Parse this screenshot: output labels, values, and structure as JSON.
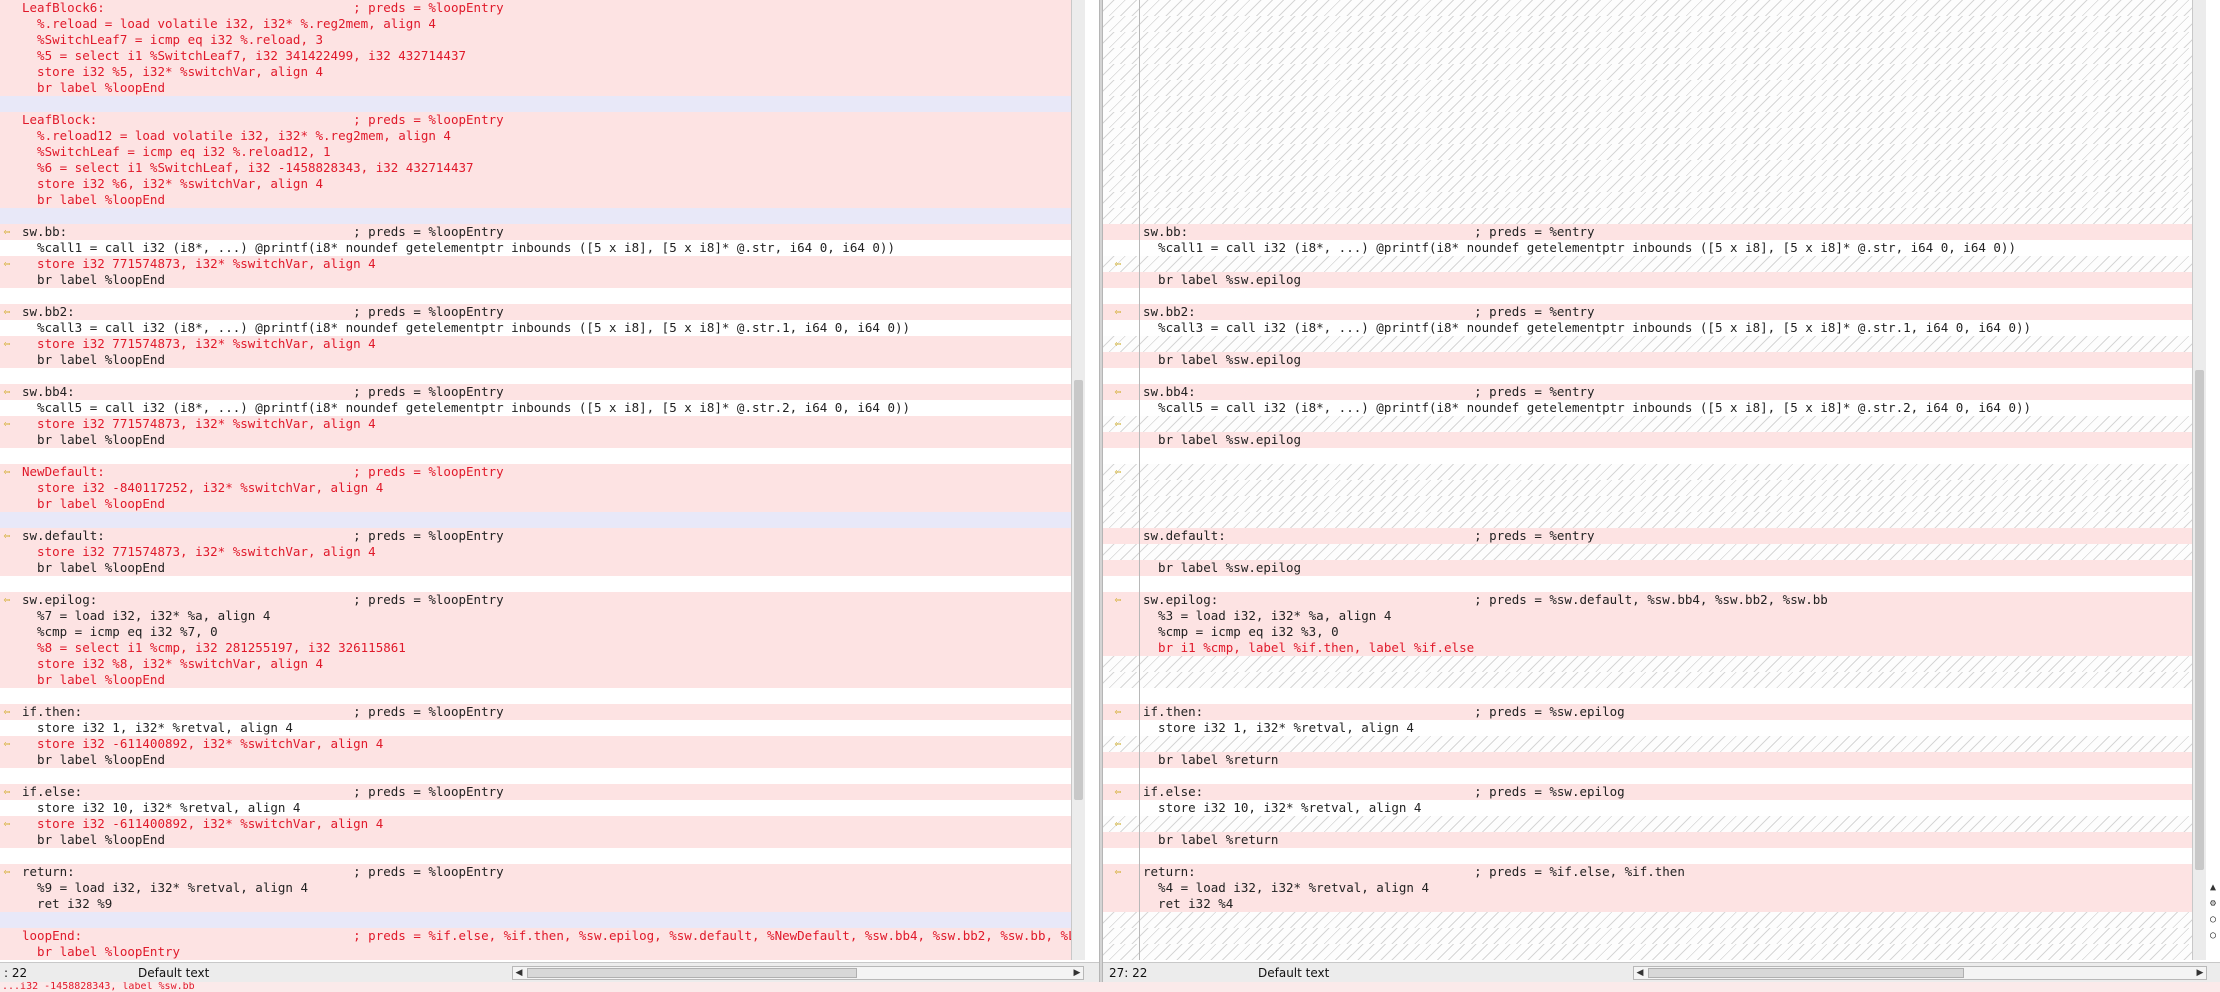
{
  "left_pane": {
    "lines": [
      {
        "text": "LeafBlock6:                                 ; preds = %loopEntry",
        "k": "hl",
        "c": 1
      },
      {
        "text": "  %.reload = load volatile i32, i32* %.reg2mem, align 4",
        "k": "hl",
        "c": 1
      },
      {
        "text": "  %SwitchLeaf7 = icmp eq i32 %.reload, 3",
        "k": "hl",
        "c": 1
      },
      {
        "text": "  %5 = select i1 %SwitchLeaf7, i32 341422499, i32 432714437",
        "k": "hl",
        "c": 1
      },
      {
        "text": "  store i32 %5, i32* %switchVar, align 4",
        "k": "hl",
        "c": 1
      },
      {
        "text": "  br label %loopEnd",
        "k": "hl",
        "c": 1
      },
      {
        "text": "",
        "k": "sep",
        "c": 0
      },
      {
        "text": "LeafBlock:                                  ; preds = %loopEntry",
        "k": "hl",
        "c": 1
      },
      {
        "text": "  %.reload12 = load volatile i32, i32* %.reg2mem, align 4",
        "k": "hl",
        "c": 1
      },
      {
        "text": "  %SwitchLeaf = icmp eq i32 %.reload12, 1",
        "k": "hl",
        "c": 1
      },
      {
        "text": "  %6 = select i1 %SwitchLeaf, i32 -1458828343, i32 432714437",
        "k": "hl",
        "c": 1
      },
      {
        "text": "  store i32 %6, i32* %switchVar, align 4",
        "k": "hl",
        "c": 1
      },
      {
        "text": "  br label %loopEnd",
        "k": "hl",
        "c": 1
      },
      {
        "text": "",
        "k": "sep",
        "c": 0
      },
      {
        "text": "sw.bb:                                      ; preds = %loopEntry",
        "k": "hl",
        "c": 0,
        "a": 1
      },
      {
        "text": "  %call1 = call i32 (i8*, ...) @printf(i8* noundef getelementptr inbounds ([5 x i8], [5 x i8]* @.str, i64 0, i64 0))",
        "k": "",
        "c": 0
      },
      {
        "text": "  store i32 771574873, i32* %switchVar, align 4",
        "k": "hl",
        "c": 1,
        "a": 1
      },
      {
        "text": "  br label %loopEnd",
        "k": "hl",
        "c": 0
      },
      {
        "text": "",
        "k": "",
        "c": 0
      },
      {
        "text": "sw.bb2:                                     ; preds = %loopEntry",
        "k": "hl",
        "c": 0,
        "a": 1
      },
      {
        "text": "  %call3 = call i32 (i8*, ...) @printf(i8* noundef getelementptr inbounds ([5 x i8], [5 x i8]* @.str.1, i64 0, i64 0))",
        "k": "",
        "c": 0
      },
      {
        "text": "  store i32 771574873, i32* %switchVar, align 4",
        "k": "hl",
        "c": 1,
        "a": 1
      },
      {
        "text": "  br label %loopEnd",
        "k": "hl",
        "c": 0
      },
      {
        "text": "",
        "k": "",
        "c": 0
      },
      {
        "text": "sw.bb4:                                     ; preds = %loopEntry",
        "k": "hl",
        "c": 0,
        "a": 1
      },
      {
        "text": "  %call5 = call i32 (i8*, ...) @printf(i8* noundef getelementptr inbounds ([5 x i8], [5 x i8]* @.str.2, i64 0, i64 0))",
        "k": "",
        "c": 0
      },
      {
        "text": "  store i32 771574873, i32* %switchVar, align 4",
        "k": "hl",
        "c": 1,
        "a": 1
      },
      {
        "text": "  br label %loopEnd",
        "k": "hl",
        "c": 0
      },
      {
        "text": "",
        "k": "",
        "c": 0
      },
      {
        "text": "NewDefault:                                 ; preds = %loopEntry",
        "k": "hl",
        "c": 1,
        "a": 1
      },
      {
        "text": "  store i32 -840117252, i32* %switchVar, align 4",
        "k": "hl",
        "c": 1
      },
      {
        "text": "  br label %loopEnd",
        "k": "hl",
        "c": 1
      },
      {
        "text": "",
        "k": "sep",
        "c": 0
      },
      {
        "text": "sw.default:                                 ; preds = %loopEntry",
        "k": "hl",
        "c": 0,
        "a": 1
      },
      {
        "text": "  store i32 771574873, i32* %switchVar, align 4",
        "k": "hl",
        "c": 1
      },
      {
        "text": "  br label %loopEnd",
        "k": "hl",
        "c": 0
      },
      {
        "text": "",
        "k": "",
        "c": 0
      },
      {
        "text": "sw.epilog:                                  ; preds = %loopEntry",
        "k": "hl",
        "c": 0,
        "a": 1
      },
      {
        "text": "  %7 = load i32, i32* %a, align 4",
        "k": "hl",
        "c": 0
      },
      {
        "text": "  %cmp = icmp eq i32 %7, 0",
        "k": "hl",
        "c": 0
      },
      {
        "text": "  %8 = select i1 %cmp, i32 281255197, i32 326115861",
        "k": "hl",
        "c": 1
      },
      {
        "text": "  store i32 %8, i32* %switchVar, align 4",
        "k": "hl",
        "c": 1
      },
      {
        "text": "  br label %loopEnd",
        "k": "hl",
        "c": 1
      },
      {
        "text": "",
        "k": "",
        "c": 0
      },
      {
        "text": "if.then:                                    ; preds = %loopEntry",
        "k": "hl",
        "c": 0,
        "a": 1
      },
      {
        "text": "  store i32 1, i32* %retval, align 4",
        "k": "",
        "c": 0
      },
      {
        "text": "  store i32 -611400892, i32* %switchVar, align 4",
        "k": "hl",
        "c": 1,
        "a": 1
      },
      {
        "text": "  br label %loopEnd",
        "k": "hl",
        "c": 0
      },
      {
        "text": "",
        "k": "",
        "c": 0
      },
      {
        "text": "if.else:                                    ; preds = %loopEntry",
        "k": "hl",
        "c": 0,
        "a": 1
      },
      {
        "text": "  store i32 10, i32* %retval, align 4",
        "k": "",
        "c": 0
      },
      {
        "text": "  store i32 -611400892, i32* %switchVar, align 4",
        "k": "hl",
        "c": 1,
        "a": 1
      },
      {
        "text": "  br label %loopEnd",
        "k": "hl",
        "c": 0
      },
      {
        "text": "",
        "k": "",
        "c": 0
      },
      {
        "text": "return:                                     ; preds = %loopEntry",
        "k": "hl",
        "c": 0,
        "a": 1
      },
      {
        "text": "  %9 = load i32, i32* %retval, align 4",
        "k": "hl",
        "c": 0
      },
      {
        "text": "  ret i32 %9",
        "k": "hl",
        "c": 0
      },
      {
        "text": "",
        "k": "sep",
        "c": 0
      },
      {
        "text": "loopEnd:                                    ; preds = %if.else, %if.then, %sw.epilog, %sw.default, %NewDefault, %sw.bb4, %sw.bb2, %sw.bb, %LeafBlock",
        "k": "hl",
        "c": 1
      },
      {
        "text": "  br label %loopEntry",
        "k": "hl",
        "c": 1
      }
    ]
  },
  "right_pane": {
    "lines": [
      {
        "text": "",
        "k": "fill",
        "c": 0
      },
      {
        "text": "",
        "k": "fill",
        "c": 0
      },
      {
        "text": "",
        "k": "fill",
        "c": 0
      },
      {
        "text": "",
        "k": "fill",
        "c": 0
      },
      {
        "text": "",
        "k": "fill",
        "c": 0
      },
      {
        "text": "",
        "k": "fill",
        "c": 0
      },
      {
        "text": "",
        "k": "fill",
        "c": 0
      },
      {
        "text": "",
        "k": "fill",
        "c": 0
      },
      {
        "text": "",
        "k": "fill",
        "c": 0
      },
      {
        "text": "",
        "k": "fill",
        "c": 0
      },
      {
        "text": "",
        "k": "fill",
        "c": 0
      },
      {
        "text": "",
        "k": "fill",
        "c": 0
      },
      {
        "text": "",
        "k": "fill",
        "c": 0
      },
      {
        "text": "",
        "k": "fill",
        "c": 0
      },
      {
        "text": "sw.bb:                                      ; preds = %entry",
        "k": "hl",
        "c": 0
      },
      {
        "text": "  %call1 = call i32 (i8*, ...) @printf(i8* noundef getelementptr inbounds ([5 x i8], [5 x i8]* @.str, i64 0, i64 0))",
        "k": "",
        "c": 0
      },
      {
        "text": "",
        "k": "fill",
        "c": 0,
        "a": 1
      },
      {
        "text": "  br label %sw.epilog",
        "k": "hl",
        "c": 0
      },
      {
        "text": "",
        "k": "",
        "c": 0
      },
      {
        "text": "sw.bb2:                                     ; preds = %entry",
        "k": "hl",
        "c": 0,
        "a": 1
      },
      {
        "text": "  %call3 = call i32 (i8*, ...) @printf(i8* noundef getelementptr inbounds ([5 x i8], [5 x i8]* @.str.1, i64 0, i64 0))",
        "k": "",
        "c": 0
      },
      {
        "text": "",
        "k": "fill",
        "c": 0,
        "a": 1
      },
      {
        "text": "  br label %sw.epilog",
        "k": "hl",
        "c": 0
      },
      {
        "text": "",
        "k": "",
        "c": 0
      },
      {
        "text": "sw.bb4:                                     ; preds = %entry",
        "k": "hl",
        "c": 0,
        "a": 1
      },
      {
        "text": "  %call5 = call i32 (i8*, ...) @printf(i8* noundef getelementptr inbounds ([5 x i8], [5 x i8]* @.str.2, i64 0, i64 0))",
        "k": "",
        "c": 0
      },
      {
        "text": "",
        "k": "fill",
        "c": 0,
        "a": 1
      },
      {
        "text": "  br label %sw.epilog",
        "k": "hl",
        "c": 0
      },
      {
        "text": "",
        "k": "",
        "c": 0
      },
      {
        "text": "",
        "k": "fill",
        "c": 0,
        "a": 1
      },
      {
        "text": "",
        "k": "fill",
        "c": 0
      },
      {
        "text": "",
        "k": "fill",
        "c": 0
      },
      {
        "text": "",
        "k": "fill",
        "c": 0
      },
      {
        "text": "sw.default:                                 ; preds = %entry",
        "k": "hl",
        "c": 0
      },
      {
        "text": "",
        "k": "fill",
        "c": 0
      },
      {
        "text": "  br label %sw.epilog",
        "k": "hl",
        "c": 0
      },
      {
        "text": "",
        "k": "",
        "c": 0
      },
      {
        "text": "sw.epilog:                                  ; preds = %sw.default, %sw.bb4, %sw.bb2, %sw.bb",
        "k": "hl",
        "c": 0,
        "a": 1
      },
      {
        "text": "  %3 = load i32, i32* %a, align 4",
        "k": "hl",
        "c": 0
      },
      {
        "text": "  %cmp = icmp eq i32 %3, 0",
        "k": "hl",
        "c": 0
      },
      {
        "text": "  br i1 %cmp, label %if.then, label %if.else",
        "k": "hl",
        "c": 1
      },
      {
        "text": "",
        "k": "fill",
        "c": 0
      },
      {
        "text": "",
        "k": "fill",
        "c": 0
      },
      {
        "text": "",
        "k": "",
        "c": 0
      },
      {
        "text": "if.then:                                    ; preds = %sw.epilog",
        "k": "hl",
        "c": 0,
        "a": 1
      },
      {
        "text": "  store i32 1, i32* %retval, align 4",
        "k": "",
        "c": 0
      },
      {
        "text": "",
        "k": "fill",
        "c": 0,
        "a": 1
      },
      {
        "text": "  br label %return",
        "k": "hl",
        "c": 0
      },
      {
        "text": "",
        "k": "",
        "c": 0
      },
      {
        "text": "if.else:                                    ; preds = %sw.epilog",
        "k": "hl",
        "c": 0,
        "a": 1
      },
      {
        "text": "  store i32 10, i32* %retval, align 4",
        "k": "",
        "c": 0
      },
      {
        "text": "",
        "k": "fill",
        "c": 0,
        "a": 1
      },
      {
        "text": "  br label %return",
        "k": "hl",
        "c": 0
      },
      {
        "text": "",
        "k": "",
        "c": 0
      },
      {
        "text": "return:                                     ; preds = %if.else, %if.then",
        "k": "hl",
        "c": 0,
        "a": 1
      },
      {
        "text": "  %4 = load i32, i32* %retval, align 4",
        "k": "hl",
        "c": 0
      },
      {
        "text": "  ret i32 %4",
        "k": "hl",
        "c": 0
      },
      {
        "text": "",
        "k": "fill",
        "c": 0
      },
      {
        "text": "",
        "k": "fill",
        "c": 0
      },
      {
        "text": "",
        "k": "fill",
        "c": 0
      }
    ]
  },
  "status": {
    "left_position": ": 22",
    "left_mode": "Default text",
    "right_position": "27: 22",
    "right_mode": "Default text"
  },
  "bottom_strip": "...i32 -1458828343, label %sw.bb",
  "icons": {
    "diff_arrow": "copy-change-arrow-icon"
  },
  "colors": {
    "changed_text": "#e0192a",
    "changed_bg": "#fde3e3",
    "arrow": "#c8a000"
  }
}
